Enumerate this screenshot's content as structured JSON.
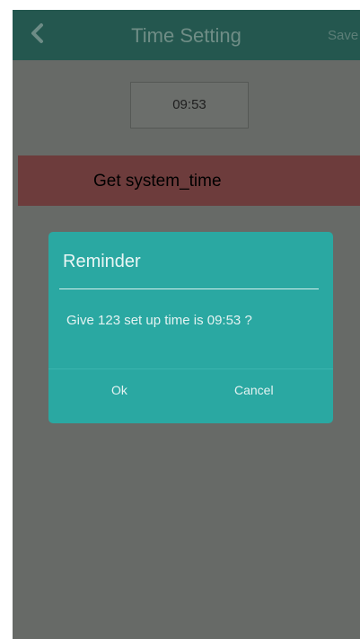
{
  "header": {
    "title": "Time Setting",
    "save_label": "Save",
    "back_icon": "chevron-left-icon"
  },
  "time_field": {
    "value": "09:53"
  },
  "toast": {
    "message": "Get system_time"
  },
  "dialog": {
    "title": "Reminder",
    "message": "Give 123 set up time is 09:53 ?",
    "ok_label": "Ok",
    "cancel_label": "Cancel"
  },
  "colors": {
    "header_bg": "#24574f",
    "screen_bg": "#676a67",
    "toast_bg": "#6d3c3c",
    "dialog_bg": "#2aa8a2"
  }
}
